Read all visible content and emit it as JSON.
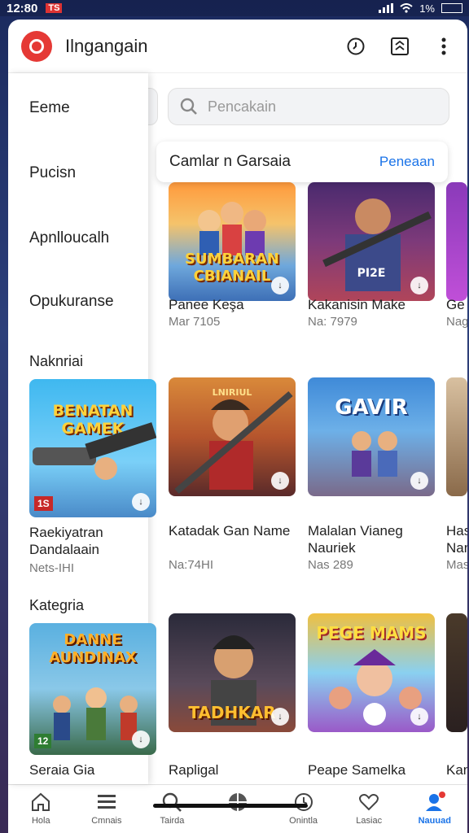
{
  "status": {
    "time": "12:80",
    "carrier": "TS",
    "battery": "1%"
  },
  "app": {
    "title": "Ilngangain"
  },
  "drawer": {
    "items": [
      "Eeme",
      "Pucisn",
      "Apnlloucalh",
      "Opukuranse",
      "Naknriai"
    ],
    "featured": {
      "title": "Raekiyatran Dandalaain",
      "meta": "Nets-IHI",
      "art_text": "BENATAN GAMEK",
      "tag": "1S"
    },
    "category_label": "Kategria",
    "category_card": {
      "title": "Seraia Gia",
      "art_text": "DANNE AUNDINAX",
      "tag": "12"
    }
  },
  "search": {
    "placeholder": "Pencakain"
  },
  "section": {
    "title": "Camlar n Garsaia",
    "link": "Peneaan"
  },
  "games": [
    {
      "title": "Panee Keşa",
      "meta": "Mar 7105",
      "art": "SUMBARAN CBIANAIL"
    },
    {
      "title": "Kakanisin Make",
      "meta": "Na: 7979",
      "art": "PI2E"
    },
    {
      "title": "Ge",
      "meta": "Nag"
    },
    {
      "title": "Katadak Gan Name",
      "meta": "Na:74HI",
      "art": "LNIRIUL"
    },
    {
      "title": "Malalan Vianeg Nauriek",
      "meta": "Nas 289",
      "art": "GAVIR"
    },
    {
      "title": "Has Nan",
      "meta": "Mas"
    },
    {
      "title": "Rapligal",
      "meta": "",
      "art": "TADHKAR"
    },
    {
      "title": "Peape Samelka",
      "meta": "",
      "art": "PEGE MAMS"
    },
    {
      "title": "Kan",
      "meta": ""
    }
  ],
  "nav": [
    {
      "label": "Hola",
      "icon": "home-icon"
    },
    {
      "label": "Cmnais",
      "icon": "menu-icon"
    },
    {
      "label": "Tairda",
      "icon": "search-icon"
    },
    {
      "label": "",
      "icon": "grid-icon"
    },
    {
      "label": "Onintla",
      "icon": "clock-icon"
    },
    {
      "label": "Lasiac",
      "icon": "heart-icon"
    },
    {
      "label": "Nauuad",
      "icon": "profile-icon"
    }
  ],
  "colors": {
    "accent": "#1a73e8",
    "logo": "#e53935"
  }
}
